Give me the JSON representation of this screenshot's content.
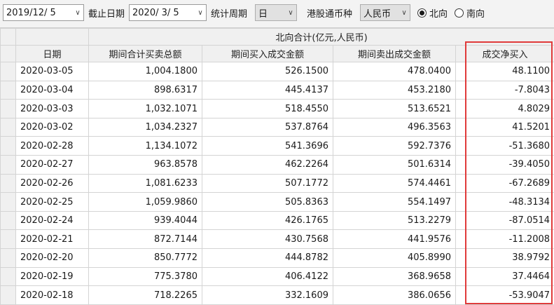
{
  "toolbar": {
    "start_date": "2019/12/ 5",
    "end_label": "截止日期",
    "end_date": "2020/ 3/ 5",
    "period_label": "统计周期",
    "period_value": "日",
    "currency_label": "港股通币种",
    "currency_value": "人民币",
    "dropdown_glyph": "∨",
    "radio_north": "北向",
    "radio_south": "南向"
  },
  "table": {
    "group_header": "北向合计(亿元,人民币)",
    "columns": [
      "日期",
      "期间合计买卖总额",
      "期间买入成交金额",
      "期间卖出成交金额",
      "成交净买入"
    ],
    "rows": [
      [
        "2020-03-05",
        "1,004.1800",
        "526.1500",
        "478.0400",
        "48.1100"
      ],
      [
        "2020-03-04",
        "898.6317",
        "445.4137",
        "453.2180",
        "-7.8043"
      ],
      [
        "2020-03-03",
        "1,032.1071",
        "518.4550",
        "513.6521",
        "4.8029"
      ],
      [
        "2020-03-02",
        "1,034.2327",
        "537.8764",
        "496.3563",
        "41.5201"
      ],
      [
        "2020-02-28",
        "1,134.1072",
        "541.3696",
        "592.7376",
        "-51.3680"
      ],
      [
        "2020-02-27",
        "963.8578",
        "462.2264",
        "501.6314",
        "-39.4050"
      ],
      [
        "2020-02-26",
        "1,081.6233",
        "507.1772",
        "574.4461",
        "-67.2689"
      ],
      [
        "2020-02-25",
        "1,059.9860",
        "505.8363",
        "554.1497",
        "-48.3134"
      ],
      [
        "2020-02-24",
        "939.4044",
        "426.1765",
        "513.2279",
        "-87.0514"
      ],
      [
        "2020-02-21",
        "872.7144",
        "430.7568",
        "441.9576",
        "-11.2008"
      ],
      [
        "2020-02-20",
        "850.7772",
        "444.8782",
        "405.8990",
        "38.9792"
      ],
      [
        "2020-02-19",
        "775.3780",
        "406.4122",
        "368.9658",
        "37.4464"
      ],
      [
        "2020-02-18",
        "718.2265",
        "332.1609",
        "386.0656",
        "-53.9047"
      ]
    ]
  },
  "colors": {
    "highlight_border": "#e03a3a"
  }
}
